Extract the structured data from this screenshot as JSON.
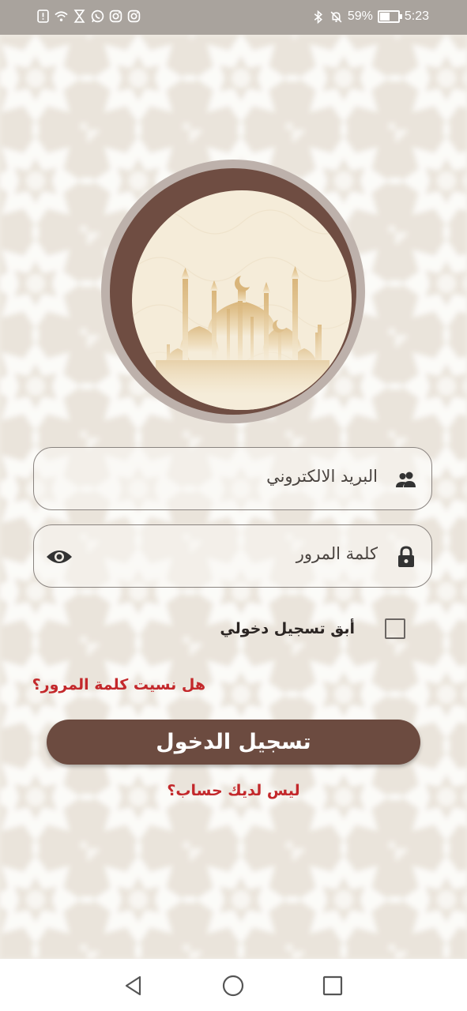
{
  "status_bar": {
    "battery_percent": "59%",
    "battery_level": 0.59,
    "time": "5:23",
    "left_icons": [
      "alert-icon",
      "wifi-icon",
      "hourglass-icon",
      "whatsapp-icon",
      "instagram-icon",
      "instagram-icon"
    ],
    "right_icons": [
      "bluetooth-icon",
      "mute-icon",
      "battery-icon"
    ]
  },
  "login": {
    "email_placeholder": "البريد الالكتروني",
    "password_placeholder": "كلمة المرور",
    "remember_label": "أبق تسجيل دخولي",
    "forgot_password": "هل نسيت كلمة المرور؟",
    "login_button": "تسجيل الدخول",
    "signup_link": "ليس لديك حساب؟"
  },
  "colors": {
    "primary_brown": "#6c4b40",
    "link_red": "#c3282b",
    "emblem_ring": "#6f4d42"
  },
  "nav_bar": {
    "buttons": [
      "back-triangle-icon",
      "home-circle-icon",
      "recents-square-icon"
    ]
  }
}
